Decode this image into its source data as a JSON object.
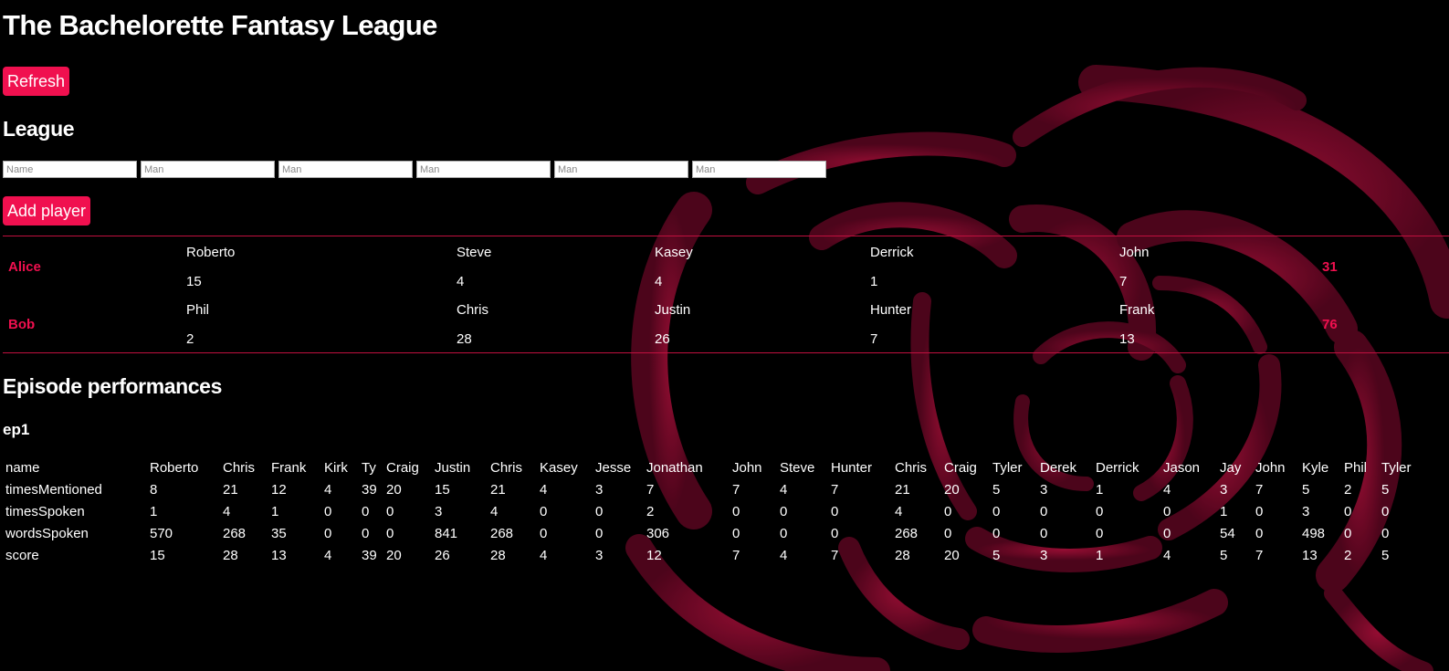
{
  "app": {
    "title": "The Bachelorette Fantasy League",
    "refresh_label": "Refresh",
    "add_player_label": "Add player"
  },
  "league": {
    "title": "League",
    "inputs": [
      {
        "placeholder": "Name",
        "value": ""
      },
      {
        "placeholder": "Man",
        "value": ""
      },
      {
        "placeholder": "Man",
        "value": ""
      },
      {
        "placeholder": "Man",
        "value": ""
      },
      {
        "placeholder": "Man",
        "value": ""
      },
      {
        "placeholder": "Man",
        "value": ""
      }
    ],
    "players": [
      {
        "name": "Alice",
        "picks": [
          {
            "man": "Roberto",
            "score": "15"
          },
          {
            "man": "Steve",
            "score": "4"
          },
          {
            "man": "Kasey",
            "score": "4"
          },
          {
            "man": "Derrick",
            "score": "1"
          },
          {
            "man": "John",
            "score": "7"
          }
        ],
        "total": "31"
      },
      {
        "name": "Bob",
        "picks": [
          {
            "man": "Phil",
            "score": "2"
          },
          {
            "man": "Chris",
            "score": "28"
          },
          {
            "man": "Justin",
            "score": "26"
          },
          {
            "man": "Hunter",
            "score": "7"
          },
          {
            "man": "Frank",
            "score": "13"
          }
        ],
        "total": "76"
      }
    ]
  },
  "episodes": {
    "title": "Episode performances",
    "list": [
      {
        "name": "ep1",
        "columns": [
          "name",
          "Roberto",
          "Chris",
          "Frank",
          "Kirk",
          "Ty",
          "Craig",
          "Justin",
          "Chris",
          "Kasey",
          "Jesse",
          "Jonathan",
          "John",
          "Steve",
          "Hunter",
          "Chris",
          "Craig",
          "Tyler",
          "Derek",
          "Derrick",
          "Jason",
          "Jay",
          "John",
          "Kyle",
          "Phil",
          "Tyler"
        ],
        "rows": [
          [
            "timesMentioned",
            "8",
            "21",
            "12",
            "4",
            "39",
            "20",
            "15",
            "21",
            "4",
            "3",
            "7",
            "7",
            "4",
            "7",
            "21",
            "20",
            "5",
            "3",
            "1",
            "4",
            "3",
            "7",
            "5",
            "2",
            "5"
          ],
          [
            "timesSpoken",
            "1",
            "4",
            "1",
            "0",
            "0",
            "0",
            "3",
            "4",
            "0",
            "0",
            "2",
            "0",
            "0",
            "0",
            "4",
            "0",
            "0",
            "0",
            "0",
            "0",
            "1",
            "0",
            "3",
            "0",
            "0"
          ],
          [
            "wordsSpoken",
            "570",
            "268",
            "35",
            "0",
            "0",
            "0",
            "841",
            "268",
            "0",
            "0",
            "306",
            "0",
            "0",
            "0",
            "268",
            "0",
            "0",
            "0",
            "0",
            "0",
            "54",
            "0",
            "498",
            "0",
            "0"
          ],
          [
            "score",
            "15",
            "28",
            "13",
            "4",
            "39",
            "20",
            "26",
            "28",
            "4",
            "3",
            "12",
            "7",
            "4",
            "7",
            "28",
            "20",
            "5",
            "3",
            "1",
            "4",
            "5",
            "7",
            "13",
            "2",
            "5"
          ]
        ]
      }
    ]
  },
  "colors": {
    "accent": "#f0104f",
    "background": "#000000",
    "rose": "#8a0a2e"
  }
}
